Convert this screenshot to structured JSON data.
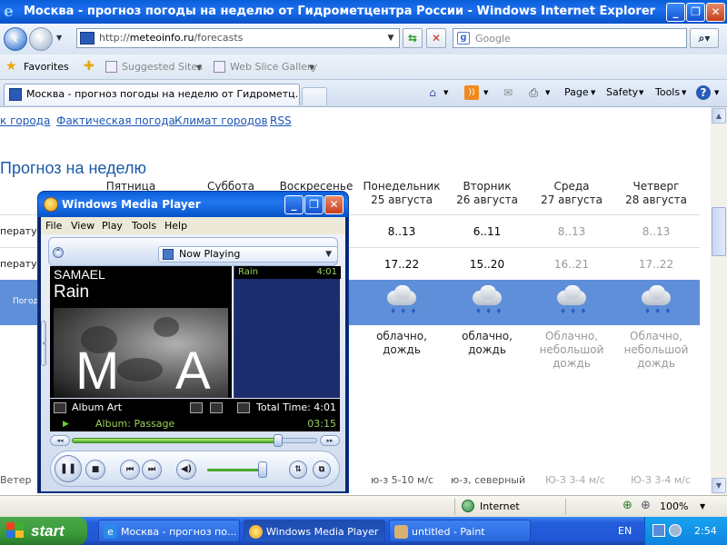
{
  "ie": {
    "title": "Москва - прогноз погоды на неделю от Гидрометцентра России - Windows Internet Explorer",
    "address_prefix": "http://",
    "address_host": "meteoinfo.ru",
    "address_path": "/forecasts",
    "search_placeholder": "Google",
    "favorites_label": "Favorites",
    "fav_links": [
      "Suggested Sites",
      "Web Slice Gallery"
    ],
    "tab_title": "Москва - прогноз погоды на неделю от Гидрометц...",
    "commands": [
      "Page",
      "Safety",
      "Tools"
    ],
    "status_zone": "Internet",
    "zoom": "100%"
  },
  "page": {
    "top_links": [
      "к города",
      "Фактическая погода",
      "Климат городов",
      "RSS"
    ],
    "forecast_title": "Прогноз на неделю",
    "days": [
      {
        "name": "Пятница",
        "date": ""
      },
      {
        "name": "Суббота",
        "date": ""
      },
      {
        "name": "Воскресенье",
        "date": ""
      },
      {
        "name": "Понедельник",
        "date": "25 августа"
      },
      {
        "name": "Вторник",
        "date": "26 августа"
      },
      {
        "name": "Среда",
        "date": "27 августа"
      },
      {
        "name": "Четверг",
        "date": "28 августа"
      }
    ],
    "row_labels": [
      "ператур",
      "ператур",
      "Погод",
      "Ветер"
    ],
    "night_temps": [
      "8..13",
      "6..11",
      "8..13",
      "8..13"
    ],
    "day_temps": [
      "17..22",
      "15..20",
      "16..21",
      "17..22"
    ],
    "descriptions": [
      "облачно, дождь",
      "облачно, дождь",
      "Облачно, небольшой дождь",
      "Облачно, небольшой дождь"
    ],
    "wind": [
      "ю-з 5-10 м/с",
      "ю-з, северный",
      "Ю-З 3-4 м/с",
      "Ю-З 3-4 м/с"
    ]
  },
  "wmp": {
    "title": "Windows Media Player",
    "menu": [
      "File",
      "View",
      "Play",
      "Tools",
      "Help"
    ],
    "now_playing": "Now Playing",
    "artist": "SAMAEL",
    "song": "Rain",
    "art_letters": [
      "M",
      "A"
    ],
    "playlist": [
      {
        "title": "Rain",
        "duration": "4:01"
      }
    ],
    "album_art_label": "Album Art",
    "total_time": "Total Time: 4:01",
    "album": "Album: Passage",
    "elapsed": "03:15",
    "progress": 0.84,
    "volume": 0.92
  },
  "taskbar": {
    "start": "start",
    "tasks": [
      "Москва - прогноз по...",
      "Windows Media Player",
      "untitled - Paint"
    ],
    "lang": "EN",
    "clock": "2:54"
  },
  "colors": {
    "xp_blue": "#0a5fd8",
    "weather_band": "#5f8fd8",
    "link": "#1d57b8",
    "wmp_green": "#9ad058"
  }
}
